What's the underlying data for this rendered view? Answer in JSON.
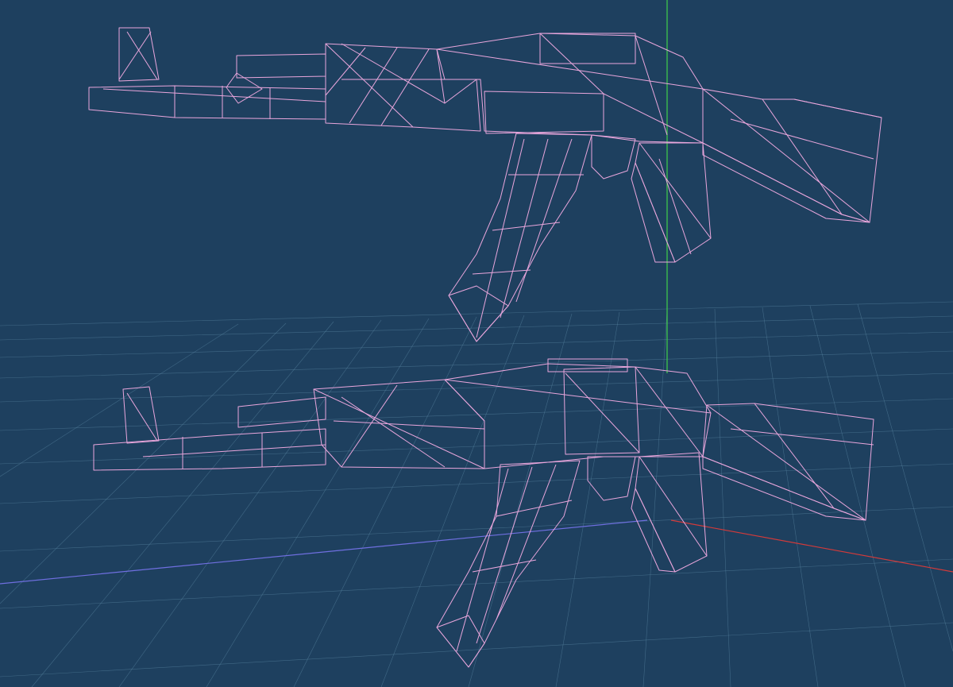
{
  "viewport": {
    "label": "",
    "colors": {
      "background": "#1e405f",
      "grid": "#5d8aa6",
      "wireframe": "#e9a6dc",
      "metal": "#5e5e5e",
      "metal_dark": "#3c3c3c",
      "wood": "#b57a61",
      "axis_x": "#d33a3a",
      "axis_y": "#3fcf4a",
      "axis_z": "#6f6fe0"
    },
    "objects": [
      {
        "name": "ak-rifle-side-view",
        "material": "metal-and-wood",
        "display": "shaded-wireframe"
      },
      {
        "name": "ak-rifle-perspective-view",
        "material": "metal-and-wood",
        "display": "shaded-wireframe"
      }
    ]
  }
}
